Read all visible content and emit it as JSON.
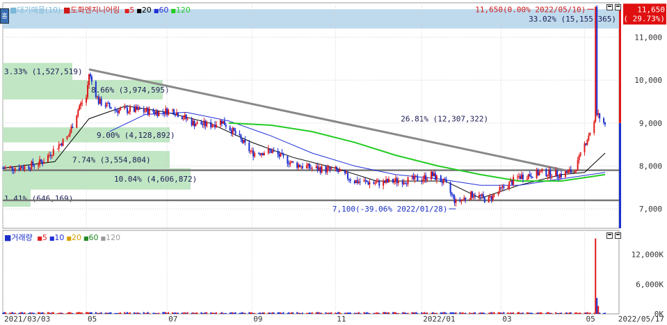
{
  "legend_main": {
    "avg_label": "■대기매물(10)",
    "name_label": "■도화엔지니어링",
    "ma": [
      {
        "label": "5",
        "color": "#e02020"
      },
      {
        "label": "20",
        "color": "#000000"
      },
      {
        "label": "60",
        "color": "#1f2fd6"
      },
      {
        "label": "120",
        "color": "#22cc22"
      }
    ]
  },
  "legend_volume": {
    "title": "■거래량",
    "ma": [
      {
        "label": "5",
        "color": "#e02020"
      },
      {
        "label": "10",
        "color": "#1f2fd6"
      },
      {
        "label": "20",
        "color": "#d8a000"
      },
      {
        "label": "60",
        "color": "#228822"
      },
      {
        "label": "120",
        "color": "#999999"
      }
    ]
  },
  "home_button": "홈",
  "chart_data": {
    "type": "candlestick",
    "price_axis": {
      "min": 6550,
      "max": 11800,
      "ticks": [
        "11,000",
        "10,000",
        "9,000",
        "8,000",
        "7,000"
      ],
      "tick_values": [
        11000,
        10000,
        9000,
        8000,
        7000
      ]
    },
    "volume_axis": {
      "min": 0,
      "max": 16000,
      "ticks": [
        "12,000K",
        "6,000K",
        "0K"
      ],
      "tick_values": [
        12000,
        6000,
        0
      ]
    },
    "x_ticks": [
      {
        "label": "2021/03/03",
        "date": "2021-03-03"
      },
      {
        "label": "05",
        "date": "2021-05-03"
      },
      {
        "label": "07",
        "date": "2021-07-01"
      },
      {
        "label": "09",
        "date": "2021-09-01"
      },
      {
        "label": "11",
        "date": "2021-11-01"
      },
      {
        "label": "2022/01",
        "date": "2022-01-03"
      },
      {
        "label": "03",
        "date": "2022-03-02"
      },
      {
        "label": "05",
        "date": "2022-05-02"
      },
      {
        "label": "2022/05/17",
        "date": "2022-05-17"
      }
    ],
    "x_range": [
      "2021-03-03",
      "2022-05-17"
    ],
    "price_path": [
      [
        "2021-03-03",
        7950
      ],
      [
        "2021-03-20",
        7980
      ],
      [
        "2021-04-01",
        8100
      ],
      [
        "2021-04-10",
        8400
      ],
      [
        "2021-04-20",
        8700
      ],
      [
        "2021-04-28",
        9400
      ],
      [
        "2021-05-03",
        9600
      ],
      [
        "2021-05-05",
        10150
      ],
      [
        "2021-05-12",
        9500
      ],
      [
        "2021-05-25",
        9300
      ],
      [
        "2021-06-10",
        9300
      ],
      [
        "2021-06-25",
        9250
      ],
      [
        "2021-07-05",
        9300
      ],
      [
        "2021-07-20",
        9000
      ],
      [
        "2021-08-01",
        8950
      ],
      [
        "2021-08-10",
        9050
      ],
      [
        "2021-08-20",
        8750
      ],
      [
        "2021-09-01",
        8300
      ],
      [
        "2021-09-15",
        8350
      ],
      [
        "2021-10-01",
        8050
      ],
      [
        "2021-10-15",
        7950
      ],
      [
        "2021-11-01",
        7900
      ],
      [
        "2021-11-15",
        7650
      ],
      [
        "2021-12-01",
        7600
      ],
      [
        "2021-12-15",
        7650
      ],
      [
        "2022-01-03",
        7700
      ],
      [
        "2022-01-10",
        7800
      ],
      [
        "2022-01-20",
        7600
      ],
      [
        "2022-01-28",
        7150
      ],
      [
        "2022-02-10",
        7350
      ],
      [
        "2022-02-20",
        7200
      ],
      [
        "2022-03-02",
        7450
      ],
      [
        "2022-03-15",
        7750
      ],
      [
        "2022-04-01",
        7850
      ],
      [
        "2022-04-15",
        7800
      ],
      [
        "2022-04-25",
        7900
      ],
      [
        "2022-05-02",
        8500
      ],
      [
        "2022-05-06",
        8800
      ],
      [
        "2022-05-09",
        9000
      ],
      [
        "2022-05-10",
        11650
      ],
      [
        "2022-05-11",
        9200
      ],
      [
        "2022-05-17",
        9000
      ]
    ],
    "ma_lines": [
      {
        "period": "20",
        "color": "#000000",
        "points": [
          [
            "2021-03-03",
            7950
          ],
          [
            "2021-04-10",
            8100
          ],
          [
            "2021-05-05",
            9100
          ],
          [
            "2021-06-01",
            9400
          ],
          [
            "2021-07-01",
            9250
          ],
          [
            "2021-08-01",
            9000
          ],
          [
            "2021-09-01",
            8550
          ],
          [
            "2021-10-01",
            8200
          ],
          [
            "2021-11-01",
            7950
          ],
          [
            "2021-12-01",
            7650
          ],
          [
            "2022-01-01",
            7650
          ],
          [
            "2022-01-20",
            7650
          ],
          [
            "2022-02-15",
            7250
          ],
          [
            "2022-03-15",
            7550
          ],
          [
            "2022-04-15",
            7800
          ],
          [
            "2022-05-02",
            7850
          ],
          [
            "2022-05-17",
            8300
          ]
        ]
      },
      {
        "period": "60",
        "color": "#1f2fd6",
        "points": [
          [
            "2021-05-20",
            8800
          ],
          [
            "2021-06-15",
            9200
          ],
          [
            "2021-07-15",
            9250
          ],
          [
            "2021-08-15",
            9050
          ],
          [
            "2021-09-15",
            8700
          ],
          [
            "2021-10-15",
            8300
          ],
          [
            "2021-11-15",
            8000
          ],
          [
            "2021-12-15",
            7800
          ],
          [
            "2022-01-15",
            7700
          ],
          [
            "2022-02-15",
            7550
          ],
          [
            "2022-03-15",
            7550
          ],
          [
            "2022-04-15",
            7700
          ],
          [
            "2022-05-17",
            7850
          ]
        ]
      },
      {
        "period": "120",
        "color": "#22cc22",
        "points": [
          [
            "2021-08-15",
            9000
          ],
          [
            "2021-09-15",
            8950
          ],
          [
            "2021-10-15",
            8800
          ],
          [
            "2021-11-15",
            8550
          ],
          [
            "2021-12-15",
            8250
          ],
          [
            "2022-01-15",
            8000
          ],
          [
            "2022-02-15",
            7800
          ],
          [
            "2022-03-15",
            7650
          ],
          [
            "2022-04-15",
            7650
          ],
          [
            "2022-05-17",
            7800
          ]
        ]
      }
    ],
    "trendline": {
      "from": [
        "2021-05-05",
        10250
      ],
      "to": [
        "2022-04-25",
        7850
      ],
      "color": "#888888"
    },
    "hlines": [
      {
        "value": 7900,
        "color": "#777777"
      },
      {
        "value": 7200,
        "color": "#777777"
      }
    ],
    "volume_profile": [
      {
        "text": "33.02% (15,155,365)",
        "lo": 11200,
        "hi": 11650,
        "color": "#b8d6ea"
      },
      {
        "text": "26.81% (12,307,322)",
        "lo": 8900,
        "hi": 9300,
        "color": "#b9e3bd"
      },
      {
        "text": "8.66% (3,974,595)",
        "lo": 9550,
        "hi": 10000,
        "color": "#b9e3bd"
      },
      {
        "text": "9.00% (4,128,892)",
        "lo": 8550,
        "hi": 8900,
        "color": "#b9e3bd"
      },
      {
        "text": "7.74% (3,554,804)",
        "lo": 7950,
        "hi": 8350,
        "color": "#b9e3bd"
      },
      {
        "text": "10.04% (4,606,872)",
        "lo": 7450,
        "hi": 7950,
        "color": "#b9e3bd"
      },
      {
        "text": "3.33% (1,527,519)",
        "lo": 10000,
        "hi": 10400,
        "color": "#b9e3bd"
      },
      {
        "text": "1.41% (646,169)",
        "lo": 7050,
        "hi": 7450,
        "color": "#b9e3bd"
      }
    ],
    "annotations": [
      {
        "text": "11,650(0.00% 2022/05/10)",
        "date": "2022-05-10",
        "value": 11650,
        "color": "#d01818"
      },
      {
        "text": "7,100(-39.06% 2022/01/28)",
        "date": "2022-01-28",
        "value": 7100,
        "color": "#1a2fc8"
      },
      {
        "text": "26.81% (12,307,322)",
        "date": "2022-01-03",
        "value": 9100,
        "color": "#000000"
      }
    ],
    "current_price": {
      "text": "11,650",
      "change": "( 29.73%)",
      "value": 11650,
      "color": "#e01010"
    },
    "volume_spikes": [
      {
        "date": "2022-05-10",
        "value": 15200
      },
      {
        "date": "2022-05-11",
        "value": 3200
      },
      {
        "date": "2022-05-12",
        "value": 1600
      }
    ],
    "baseline_volume": 250
  }
}
